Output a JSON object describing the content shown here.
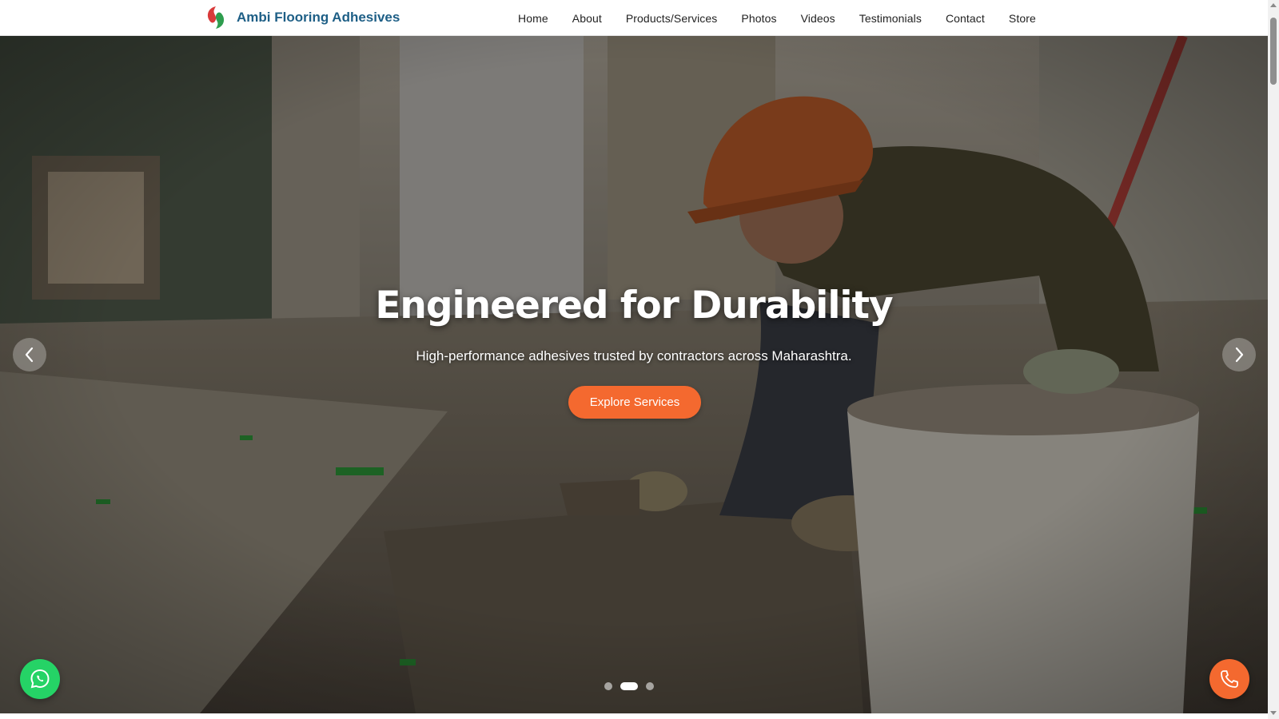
{
  "brand": {
    "name": "Ambi Flooring Adhesives",
    "logo_icon": "leaf-swirl-logo",
    "color": "#1e5f86",
    "logo_colors": [
      "#d93a3a",
      "#2e9d4e"
    ]
  },
  "nav": {
    "items": [
      {
        "label": "Home"
      },
      {
        "label": "About"
      },
      {
        "label": "Products/Services"
      },
      {
        "label": "Photos"
      },
      {
        "label": "Videos"
      },
      {
        "label": "Testimonials"
      },
      {
        "label": "Contact"
      },
      {
        "label": "Store"
      }
    ]
  },
  "hero": {
    "title": "Engineered for Durability",
    "subtitle": "High-performance adhesives trusted by contractors across Maharashtra.",
    "cta_label": "Explore Services",
    "cta_color": "#f4692f",
    "prev_icon": "chevron-left-icon",
    "next_icon": "chevron-right-icon",
    "slide_count": 3,
    "active_slide": 2
  },
  "floating": {
    "whatsapp_icon": "whatsapp-icon",
    "whatsapp_color": "#25d366",
    "phone_icon": "phone-icon",
    "phone_color": "#f4692f"
  }
}
